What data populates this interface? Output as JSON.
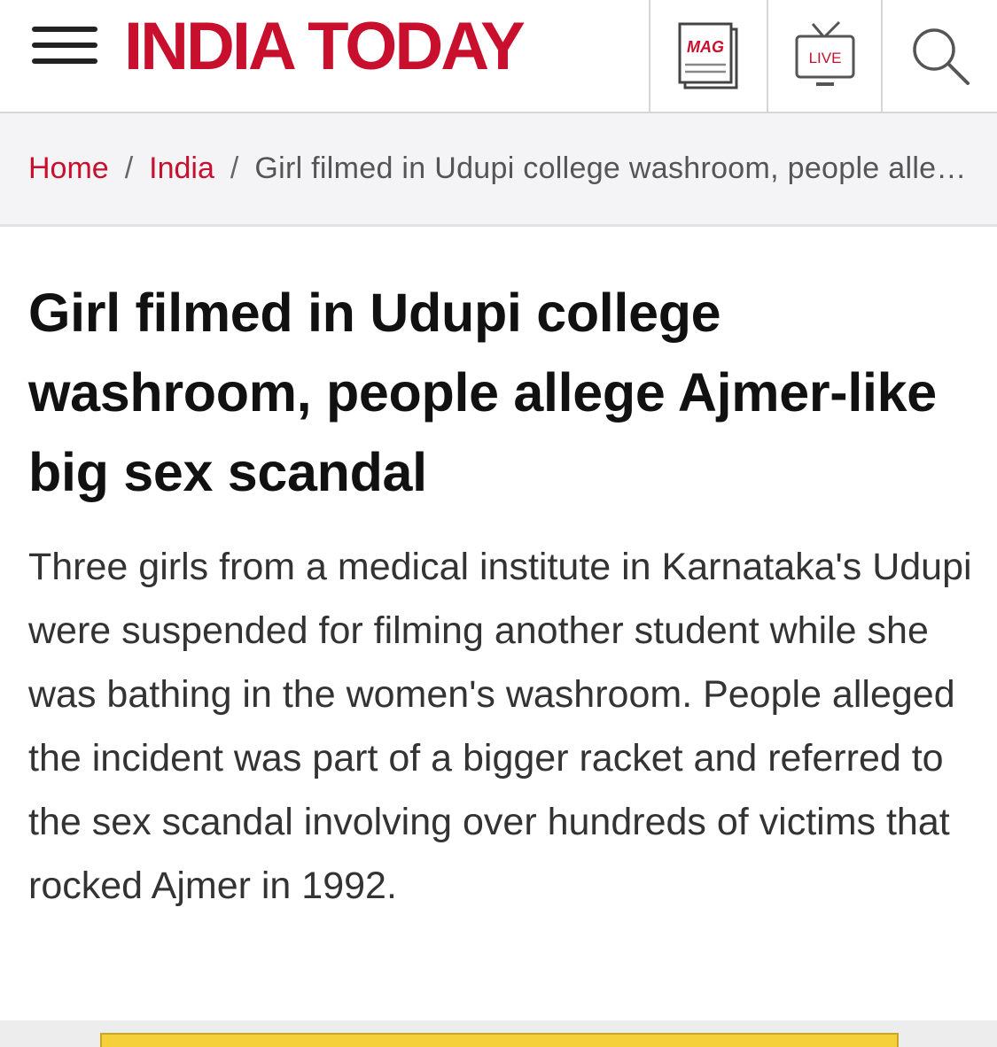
{
  "header": {
    "brand": "INDIA TODAY",
    "brand_color": "#c8102e",
    "menu_icon": "hamburger-menu-icon",
    "buttons": [
      {
        "name": "magazine",
        "icon": "magazine-icon",
        "label": "MAG"
      },
      {
        "name": "live-tv",
        "icon": "live-tv-icon",
        "label": "LIVE"
      },
      {
        "name": "search",
        "icon": "search-icon"
      }
    ]
  },
  "breadcrumb": {
    "home": "Home",
    "section": "India",
    "separator": "/",
    "current": "Girl filmed in Udupi college washroom, people allege Ajmer-like big sex scandal"
  },
  "article": {
    "headline": "Girl filmed in Udupi college washroom, people allege Ajmer-like big sex scandal",
    "summary": "Three girls from a medical institute in Karnataka's Udupi were suspended for filming another student while she was bathing in the women's washroom. People alleged the incident was part of a bigger racket and referred to the sex scandal involving over hundreds of victims that rocked Ajmer in 1992."
  }
}
